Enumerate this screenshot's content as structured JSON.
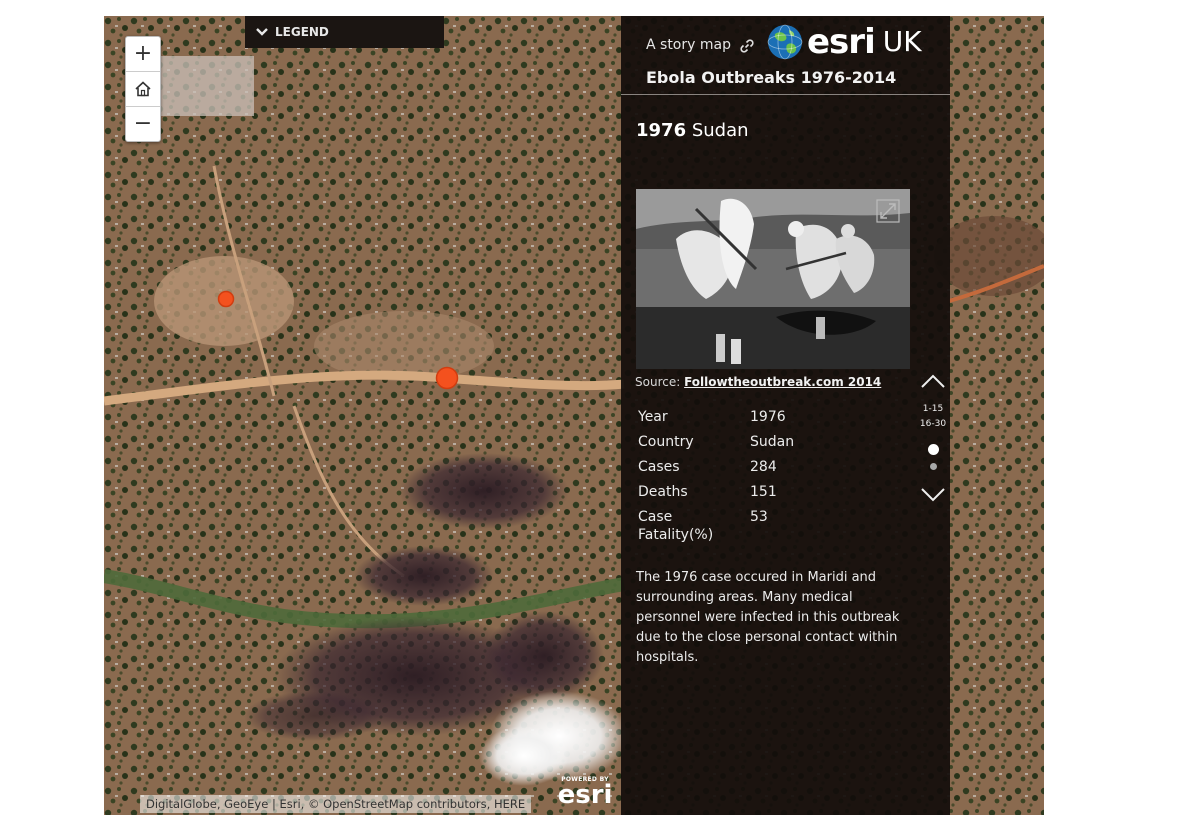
{
  "map": {
    "legend_label": "LEGEND",
    "zoom_in_label": "+",
    "zoom_out_label": "−",
    "home_icon": "home-icon",
    "attribution": "DigitalGlobe, GeoEye | Esri, © OpenStreetMap contributors, HERE",
    "powered_by": {
      "small": "POWERED BY",
      "big": "esri"
    },
    "marker_color": "#f4511e"
  },
  "panel": {
    "tagline": "A story map",
    "logo": {
      "word": "esri",
      "region": "UK"
    },
    "title": "Ebola Outbreaks 1976-2014",
    "section": {
      "year": "1976",
      "country": "Sudan"
    },
    "photo_source_label": "Source:",
    "photo_source_link": "Followtheoutbreak.com 2014",
    "attributes": [
      {
        "key": "Year",
        "value": "1976"
      },
      {
        "key": "Country",
        "value": "Sudan"
      },
      {
        "key": "Cases",
        "value": "284"
      },
      {
        "key": "Deaths",
        "value": "151"
      },
      {
        "key": "Case Fatality(%)",
        "value": "53"
      }
    ],
    "description": "The 1976 case occured in Maridi and surrounding areas. Many medical personnel were infected in this outbreak due to the close personal contact within hospitals.",
    "navigation": {
      "ranges": [
        "1-15",
        "16-30"
      ],
      "active_dot_color": "#ffffff",
      "inactive_dot_color": "#a8a8a8"
    }
  }
}
